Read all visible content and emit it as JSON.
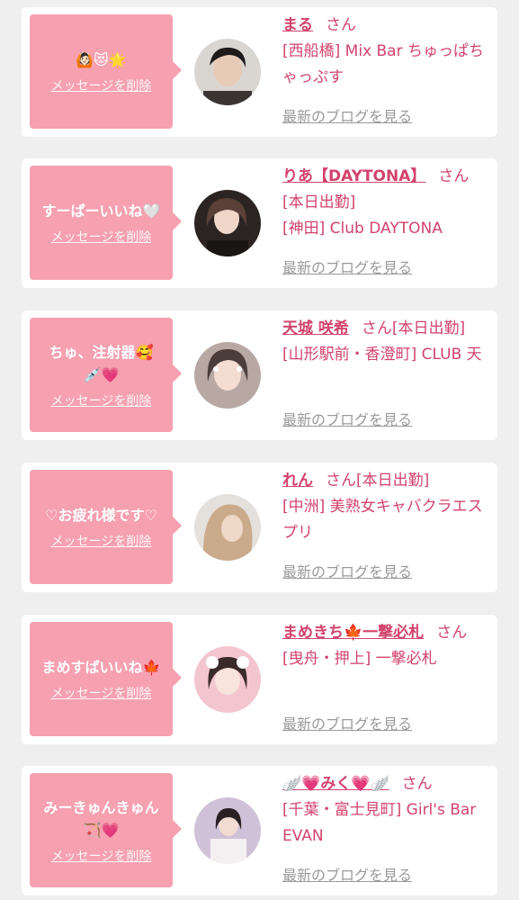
{
  "theme": {
    "accent": "#d2436c",
    "bubble": "#f6a0b0",
    "card_bg": "#ffffff",
    "page_bg": "#efefef",
    "link_gray": "#999999"
  },
  "delete_label": "メッセージを削除",
  "blog_label": "最新のブログを見る",
  "san_label": "さん",
  "items": [
    {
      "message": "🙆🏻😻🌟",
      "name": "まる",
      "status": "",
      "shop": "[西船橋] Mix Bar ちゅっぱちゃっぷす",
      "avatar_icon": "avatar-photo"
    },
    {
      "message": "すーぱーいいね🤍",
      "name": "りあ【DAYTONA】",
      "status": "[本日出勤]",
      "shop": "[神田] Club DAYTONA",
      "avatar_icon": "avatar-photo"
    },
    {
      "message": "ちゅ、注射器🥰\n💉💗",
      "name": "天城 咲希",
      "status": "[本日出勤]",
      "shop": "[山形駅前・香澄町] CLUB 天",
      "avatar_icon": "avatar-photo"
    },
    {
      "message": "♡お疲れ様です♡",
      "name": "れん",
      "status": "[本日出勤]",
      "shop": "[中洲] 美熟女キャバクラエスプリ",
      "avatar_icon": "avatar-photo"
    },
    {
      "message": "まめすぱいいね🍁",
      "name": "まめきち🍁一撃必札",
      "status": "",
      "shop": "[曳舟・押上] 一撃必札",
      "avatar_icon": "avatar-photo"
    },
    {
      "message": "みーきゅんきゅん\n🏹💗",
      "name": "🪽💗みく💗🪽",
      "status": "",
      "shop": "[千葉・富士見町] Girl's Bar EVAN",
      "avatar_icon": "avatar-photo"
    }
  ]
}
